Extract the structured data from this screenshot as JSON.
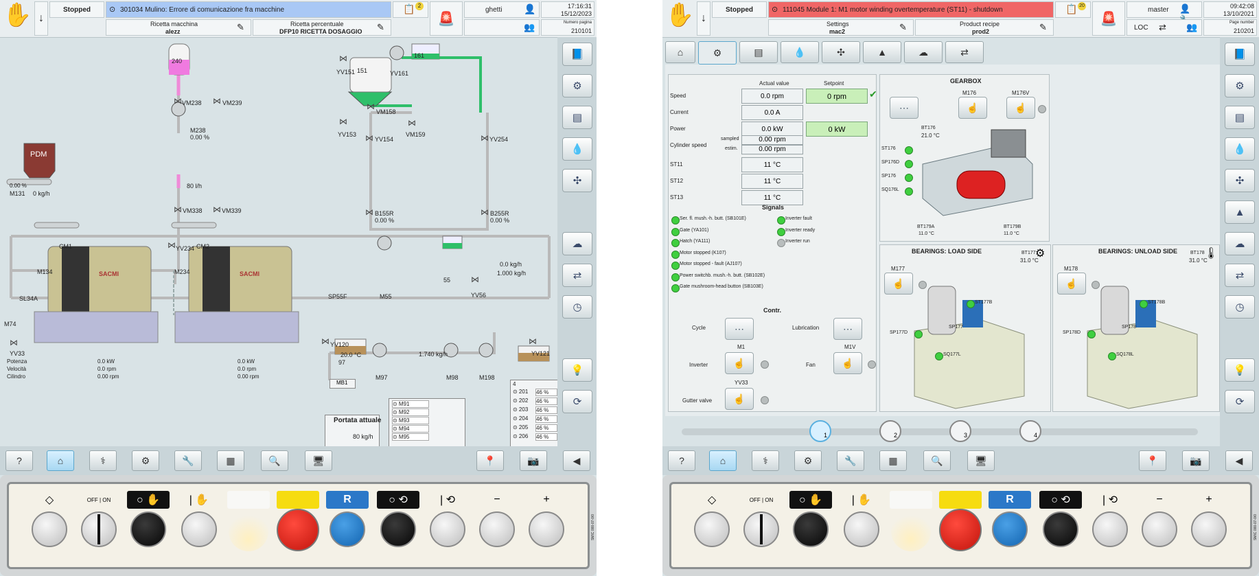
{
  "left": {
    "status": "Stopped",
    "alarm_code": "301034 Mulino: Errore di comunicazione fra macchine",
    "alarm_badge": "2",
    "user": "ghetti",
    "time": "17:16:31",
    "date": "15/12/2023",
    "page_label": "Numero pagina",
    "page_number": "210101",
    "recipe_machine_label": "Ricetta macchina",
    "recipe_machine_value": "alezz",
    "recipe_percent_label": "Ricetta percentuale",
    "recipe_percent_value": "DFP10 RICETTA DOSAGGIO",
    "labels": {
      "t240": "240",
      "vm238": "VM238",
      "vm239": "VM239",
      "m238": "M238",
      "m238_pct": "0.00 %",
      "flow": "80 l/h",
      "vm338": "VM338",
      "vm339": "VM339",
      "pdm": "PDM",
      "m131": "M131",
      "m131_pct": "0.00 %",
      "m131_flow": "0 kg/h",
      "cm1": "CM1",
      "cm2": "CM2",
      "m134": "M134",
      "m234": "M234",
      "yv234": "YV234",
      "sl34a": "SL34A",
      "m74": "M74",
      "yv33": "YV33",
      "sp55f": "SP55F",
      "m55": "M55",
      "s55": "55",
      "yv56": "YV56",
      "yv151": "YV151",
      "t151": "151",
      "yv161": "YV161",
      "t161": "161",
      "vm158": "VM158",
      "yv153": "YV153",
      "yv154": "YV154",
      "vm159": "VM159",
      "yv254": "YV254",
      "b155r": "B155R",
      "b155r_pct": "0.00 %",
      "b255r": "B255R",
      "b255r_pct": "0.00 %",
      "feed_kg": "0.0 kg/h",
      "feed_kg2": "1.000 kg/h",
      "yv120": "YV120",
      "temp": "20.0 °C",
      "t97": "97",
      "m97": "M97",
      "flow2": "1.740 kg/h",
      "m98": "M98",
      "m198": "M198",
      "yv121": "YV121",
      "mb1": "MB1",
      "portata_title": "Portata attuale",
      "portata_value": "80 kg/h",
      "sacmi": "SACMI"
    },
    "mill_table": {
      "rows": [
        {
          "label": "Potenza",
          "v1": "0.0 kW",
          "v2": "0.0 kW"
        },
        {
          "label": "Velocità",
          "v1": "0.0 rpm",
          "v2": "0.0 rpm"
        },
        {
          "label": "Cilindro",
          "v1": "0.00 rpm",
          "v2": "0.00 rpm"
        }
      ]
    },
    "motors_list": [
      "M91",
      "M92",
      "M93",
      "M94",
      "M95"
    ],
    "tanks": [
      {
        "id": "201",
        "pct": "46 %"
      },
      {
        "id": "202",
        "pct": "46 %"
      },
      {
        "id": "203",
        "pct": "46 %"
      },
      {
        "id": "204",
        "pct": "46 %"
      },
      {
        "id": "205",
        "pct": "46 %"
      },
      {
        "id": "206",
        "pct": "46 %"
      }
    ],
    "tank_header": "4"
  },
  "right": {
    "status": "Stopped",
    "alarm_code": "111045 Module 1: M1 motor winding overtemperature (ST11) - shutdown",
    "alarm_badge": "20",
    "user": "master",
    "time": "09:42:08",
    "date": "13/10/2021",
    "page_label": "Page number",
    "page_number": "210201",
    "settings_label": "Settings",
    "settings_value": "mac2",
    "recipe_label": "Product recipe",
    "recipe_value": "prod2",
    "loc": "LOC",
    "measures_header_actual": "Actual value",
    "measures_header_setpoint": "Setpoint",
    "measures": [
      {
        "label": "Speed",
        "actual": "0.0 rpm",
        "setpoint": "0 rpm"
      },
      {
        "label": "Current",
        "actual": "0.0 A",
        "setpoint": ""
      },
      {
        "label": "Power",
        "actual": "0.0 kW",
        "setpoint": "0 kW"
      }
    ],
    "cyl_label": "Cylinder speed",
    "cyl_sampled_label": "sampled",
    "cyl_sampled": "0.00 rpm",
    "cyl_estim_label": "estim.",
    "cyl_estim": "0.00 rpm",
    "temps": [
      {
        "label": "ST11",
        "value": "11 °C"
      },
      {
        "label": "ST12",
        "value": "11 °C"
      },
      {
        "label": "ST13",
        "value": "11 °C"
      }
    ],
    "signals_title": "Signals",
    "signals_left": [
      "Ser. fl. mush.-h. butt. (SB101E)",
      "Gate (YA101)",
      "Hatch (YA111)",
      "Motor stopped (K107)",
      "Motor stopped - fault (AJ107)",
      "Power switchb. mush.-h. butt. (SB102E)",
      "Gate mushroom-head button (SB103E)"
    ],
    "signals_right": [
      "Inverter fault",
      "Inverter ready",
      "Inverter run"
    ],
    "contr_title": "Contr.",
    "contr": {
      "cycle": "Cycle",
      "lubrication": "Lubrication",
      "m1": "M1",
      "m1v": "M1V",
      "inverter": "Inverter",
      "fan": "Fan",
      "yv33": "YV33",
      "gutter": "Gutter valve"
    },
    "gearbox": {
      "title": "GEARBOX",
      "m176": "M176",
      "m176v": "M176V",
      "bt176": "BT176",
      "bt176_temp": "21.0 °C",
      "st176": "ST176",
      "sp176d": "SP176D",
      "sp176": "SP176",
      "sq176l": "SQ176L",
      "bt179a": "BT179A",
      "bt179a_temp": "11.0 °C",
      "bt179b": "BT179B",
      "bt179b_temp": "11.0 °C"
    },
    "load_side": {
      "title": "BEARINGS: LOAD SIDE",
      "m177": "M177",
      "bt177": "BT177",
      "bt177_temp": "31.0 °C",
      "st177b": "ST177B",
      "sp177d": "SP177D",
      "sp177": "SP177",
      "sq177l": "SQ177L"
    },
    "unload_side": {
      "title": "BEARINGS: UNLOAD SIDE",
      "m178": "M178",
      "bt178": "BT178",
      "bt178_temp": "31.0 °C",
      "st178b": "ST178B",
      "sp178d": "SP178D",
      "sp178": "SP178",
      "sq178l": "SQ178L"
    },
    "pages": [
      "1",
      "2",
      "3",
      "4"
    ],
    "page_active": "1"
  },
  "panel": {
    "off_on_off": "OFF",
    "off_on_on": "ON",
    "reset_label": "R",
    "minus": "−",
    "plus": "+",
    "code": "SMIC 000-07-0/0"
  },
  "colors": {
    "alarm_left": "#a9c8f5",
    "alarm_right": "#f06666",
    "pipe_green": "#2fbf6a",
    "pipe_grey": "#b9b9b9",
    "pipe_pink": "#f08ad8"
  }
}
